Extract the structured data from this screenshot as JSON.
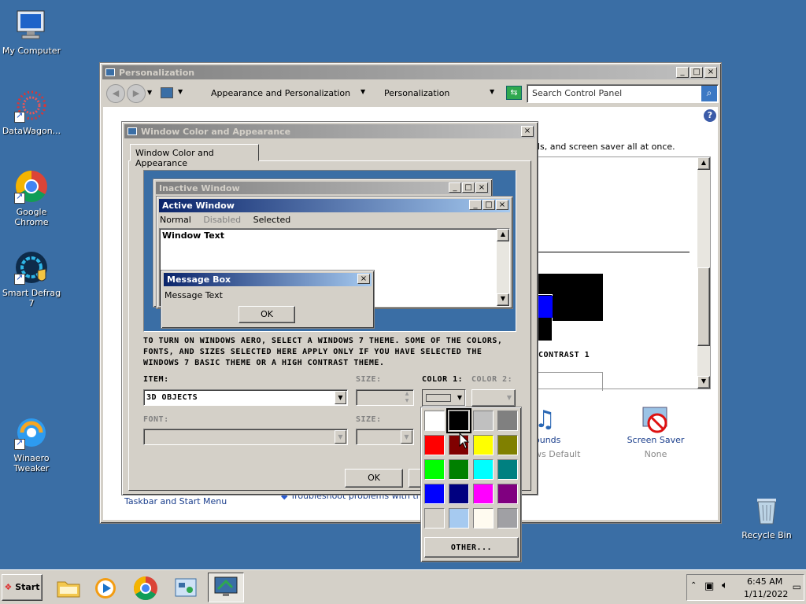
{
  "desktop": {
    "icons": [
      {
        "label": "My Computer"
      },
      {
        "label": "DataWagon..."
      },
      {
        "label": "Google Chrome"
      },
      {
        "label": "Smart Defrag 7"
      },
      {
        "label": "Winaero Tweaker"
      },
      {
        "label": "Recycle Bin"
      }
    ]
  },
  "personalization": {
    "title": "Personalization",
    "breadcrumb": [
      "Appearance and Personalization",
      "Personalization"
    ],
    "search_placeholder": "Search Control Panel",
    "desc_fragment": "ds, and screen saver all at once.",
    "contrast_label": "CONTRAST 1",
    "sounds": {
      "label": "ounds",
      "value": "ws Default"
    },
    "screen_saver": {
      "label": "Screen Saver",
      "value": "None"
    },
    "taskbar_link": "Taskbar and Start Menu",
    "troubleshoot_link": "Troubleshoot problems with transparency and other visual effects"
  },
  "dialog": {
    "title": "Window Color and Appearance",
    "tab": "Window Color and Appearance",
    "preview": {
      "inactive_title": "Inactive Window",
      "active_title": "Active Window",
      "menu": [
        "Normal",
        "Disabled",
        "Selected"
      ],
      "window_text": "Window Text",
      "msg_title": "Message Box",
      "msg_text": "Message Text",
      "msg_ok": "OK"
    },
    "instructions": "TO TURN ON WINDOWS AERO, SELECT A WINDOWS 7 THEME. SOME OF THE COLORS, FONTS, AND SIZES SELECTED HERE APPLY ONLY IF YOU HAVE SELECTED THE WINDOWS 7 BASIC THEME OR A HIGH CONTRAST THEME.",
    "item_label": "ITEM:",
    "item_value": "3D OBJECTS",
    "size_label": "SIZE:",
    "color1_label": "COLOR 1:",
    "color2_label": "COLOR 2:",
    "font_label": "FONT:",
    "size2_label": "SIZE:",
    "ok": "OK"
  },
  "palette": {
    "colors": [
      "#ffffff",
      "#000000",
      "#c0c0c0",
      "#808080",
      "#ff0000",
      "#800000",
      "#ffff00",
      "#808000",
      "#00ff00",
      "#008000",
      "#00ffff",
      "#008080",
      "#0000ff",
      "#000080",
      "#ff00ff",
      "#800080",
      "#d4d0c8",
      "#a6caf0",
      "#fffbf0",
      "#a0a0a4"
    ],
    "selected": 1,
    "other_label": "OTHER..."
  },
  "taskbar": {
    "start": "Start",
    "time": "6:45 AM",
    "date": "1/11/2022"
  }
}
